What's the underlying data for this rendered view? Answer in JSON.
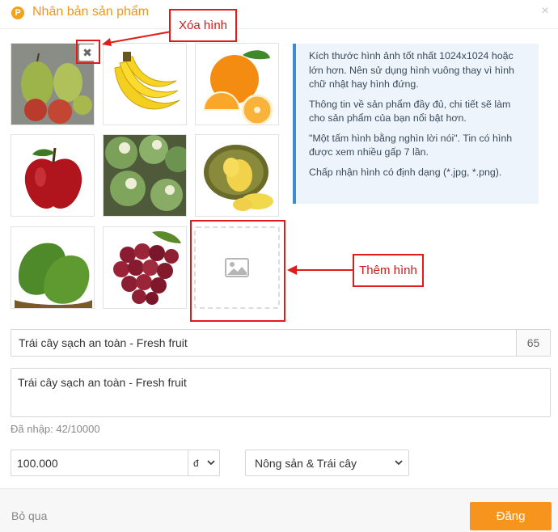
{
  "header": {
    "logo_letter": "P",
    "title": "Nhân bản sản phẩm",
    "close_symbol": "×"
  },
  "gallery": {
    "remove_symbol": "✖",
    "images": [
      {
        "name": "pear-photo"
      },
      {
        "name": "banana-photo"
      },
      {
        "name": "orange-photo"
      },
      {
        "name": "apple-photo"
      },
      {
        "name": "coconut-photo"
      },
      {
        "name": "durian-photo"
      },
      {
        "name": "soursop-photo"
      },
      {
        "name": "grape-photo"
      }
    ],
    "add_icon": "image-icon"
  },
  "annotations": {
    "remove_label": "Xóa hình",
    "add_label": "Thêm hình"
  },
  "info_panel": {
    "lines": [
      "Kích thước hình ảnh tốt nhất 1024x1024 hoặc lớn hơn. Nên sử dụng hình vuông thay vì hình chữ nhật hay hình đứng.",
      "Thông tin về sản phẩm đầy đủ, chi tiết sẽ làm cho sản phẩm của bạn nổi bật hơn.",
      "\"Một tấm hình bằng nghìn lời nói\". Tin có hình được xem nhiều gấp 7 lần.",
      "Chấp nhận hình có định dạng (*.jpg, *.png)."
    ]
  },
  "form": {
    "title_value": "Trái cây sạch an toàn - Fresh fruit",
    "title_remaining": "65",
    "description_value": "Trái cây sạch an toàn - Fresh fruit",
    "typed_count_label": "Đã nhập: 42/10000",
    "price_value": "100.000",
    "currency_symbol": "đ",
    "category_value": "Nông sản & Trái cây"
  },
  "footer": {
    "skip_label": "Bỏ qua",
    "post_label": "Đăng"
  },
  "colors": {
    "accent": "#f7941d",
    "annotation": "#e01b1b",
    "info_border": "#3b8cd4"
  }
}
